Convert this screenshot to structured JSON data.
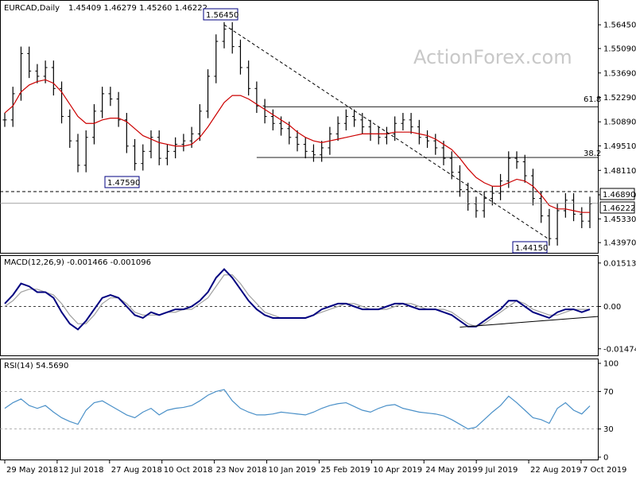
{
  "header": {
    "symbol": "EURCAD,Daily",
    "ohlc": "1.45409 1.46279 1.45260 1.46222",
    "watermark": "ActionForex.com"
  },
  "colors": {
    "candles": "#000000",
    "sma": "#cc0000",
    "macd_line": "#000080",
    "macd_signal": "#a0a0a0",
    "rsi_line": "#4a90c8",
    "trend_line": "#000000",
    "level_line": "#000000"
  },
  "chart_data": [
    {
      "type": "line",
      "panel": "price",
      "title": "EURCAD,Daily",
      "ylim": [
        1.4375,
        1.5705
      ],
      "y_ticks": [
        "1.56450",
        "1.55090",
        "1.53690",
        "1.52290",
        "1.50890",
        "1.49510",
        "1.48110",
        "1.46710",
        "1.45330",
        "1.43970"
      ],
      "x_ticks": [
        "29 May 2018",
        "12 Jul 2018",
        "27 Aug 2018",
        "10 Oct 2018",
        "23 Nov 2018",
        "10 Jan 2019",
        "25 Feb 2019",
        "10 Apr 2019",
        "24 May 2019",
        "9 Jul 2019",
        "22 Aug 2019",
        "7 Oct 2019"
      ],
      "series": [
        {
          "kind": "ohlc-close",
          "x": [
            "2018-05-29",
            "2018-06-05",
            "2018-06-12",
            "2018-06-19",
            "2018-06-26",
            "2018-07-03",
            "2018-07-10",
            "2018-07-17",
            "2018-07-24",
            "2018-07-31",
            "2018-08-07",
            "2018-08-14",
            "2018-08-21",
            "2018-08-28",
            "2018-09-04",
            "2018-09-11",
            "2018-09-18",
            "2018-09-25",
            "2018-10-02",
            "2018-10-09",
            "2018-10-16",
            "2018-10-23",
            "2018-10-30",
            "2018-11-06",
            "2018-11-13",
            "2018-11-20",
            "2018-11-27",
            "2018-12-04",
            "2018-12-11",
            "2018-12-18",
            "2018-12-25",
            "2019-01-01",
            "2019-01-08",
            "2019-01-15",
            "2019-01-22",
            "2019-01-29",
            "2019-02-05",
            "2019-02-12",
            "2019-02-19",
            "2019-02-26",
            "2019-03-05",
            "2019-03-12",
            "2019-03-19",
            "2019-03-26",
            "2019-04-02",
            "2019-04-09",
            "2019-04-16",
            "2019-04-23",
            "2019-04-30",
            "2019-05-07",
            "2019-05-14",
            "2019-05-21",
            "2019-05-28",
            "2019-06-04",
            "2019-06-11",
            "2019-06-18",
            "2019-06-25",
            "2019-07-02",
            "2019-07-09",
            "2019-07-16",
            "2019-07-23",
            "2019-07-30",
            "2019-08-06",
            "2019-08-13",
            "2019-08-20",
            "2019-08-27",
            "2019-09-03",
            "2019-09-10",
            "2019-09-17",
            "2019-09-24",
            "2019-10-01",
            "2019-10-08",
            "2019-10-15"
          ],
          "values": [
            1.51,
            1.525,
            1.548,
            1.538,
            1.535,
            1.54,
            1.528,
            1.512,
            1.498,
            1.484,
            1.5,
            1.515,
            1.525,
            1.522,
            1.51,
            1.495,
            1.485,
            1.492,
            1.5,
            1.488,
            1.492,
            1.496,
            1.498,
            1.502,
            1.515,
            1.535,
            1.555,
            1.562,
            1.552,
            1.54,
            1.528,
            1.518,
            1.512,
            1.508,
            1.505,
            1.5,
            1.496,
            1.492,
            1.49,
            1.494,
            1.502,
            1.508,
            1.512,
            1.51,
            1.506,
            1.502,
            1.5,
            1.502,
            1.508,
            1.51,
            1.506,
            1.5,
            1.498,
            1.494,
            1.488,
            1.48,
            1.47,
            1.462,
            1.458,
            1.465,
            1.468,
            1.475,
            1.488,
            1.486,
            1.478,
            1.465,
            1.455,
            1.442,
            1.458,
            1.464,
            1.456,
            1.452,
            1.462
          ]
        },
        {
          "kind": "sma",
          "values": [
            1.514,
            1.518,
            1.526,
            1.53,
            1.532,
            1.533,
            1.531,
            1.526,
            1.519,
            1.512,
            1.508,
            1.508,
            1.51,
            1.511,
            1.511,
            1.509,
            1.505,
            1.501,
            1.499,
            1.497,
            1.496,
            1.495,
            1.495,
            1.496,
            1.5,
            1.506,
            1.513,
            1.52,
            1.524,
            1.524,
            1.522,
            1.519,
            1.516,
            1.513,
            1.51,
            1.507,
            1.503,
            1.5,
            1.498,
            1.497,
            1.498,
            1.499,
            1.5,
            1.501,
            1.502,
            1.502,
            1.502,
            1.502,
            1.503,
            1.503,
            1.503,
            1.502,
            1.501,
            1.499,
            1.496,
            1.493,
            1.488,
            1.482,
            1.477,
            1.474,
            1.472,
            1.472,
            1.474,
            1.476,
            1.475,
            1.472,
            1.467,
            1.461,
            1.459,
            1.459,
            1.458,
            1.457,
            1.457
          ]
        }
      ],
      "annotations": {
        "high_label": "1.56450",
        "low_label_1": "1.47590",
        "low_label_2": "1.44150",
        "level_label": "1.46890",
        "last_label": "1.46222",
        "fib_618": "61.8",
        "fib_382": "38.2"
      }
    },
    {
      "type": "line",
      "panel": "macd",
      "title": "MACD(12,26,9) -0.001466 -0.001096",
      "ylim": [
        -0.0162,
        0.0162
      ],
      "y_ticks": [
        "0.015137",
        "0.00",
        "-0.014749"
      ],
      "series": [
        {
          "name": "MACD",
          "values": [
            0.001,
            0.004,
            0.008,
            0.007,
            0.005,
            0.005,
            0.003,
            -0.002,
            -0.006,
            -0.008,
            -0.005,
            -0.001,
            0.003,
            0.004,
            0.003,
            0.0,
            -0.003,
            -0.004,
            -0.002,
            -0.003,
            -0.002,
            -0.001,
            -0.001,
            0.0,
            0.002,
            0.005,
            0.01,
            0.013,
            0.01,
            0.006,
            0.002,
            -0.001,
            -0.003,
            -0.004,
            -0.004,
            -0.004,
            -0.004,
            -0.004,
            -0.003,
            -0.001,
            0.0,
            0.001,
            0.001,
            0.0,
            -0.001,
            -0.001,
            -0.001,
            0.0,
            0.001,
            0.001,
            0.0,
            -0.001,
            -0.001,
            -0.001,
            -0.002,
            -0.003,
            -0.005,
            -0.007,
            -0.007,
            -0.005,
            -0.003,
            -0.001,
            0.002,
            0.002,
            0.0,
            -0.002,
            -0.003,
            -0.004,
            -0.002,
            -0.001,
            -0.001,
            -0.002,
            -0.001
          ]
        },
        {
          "name": "Signal",
          "values": [
            0.0,
            0.002,
            0.005,
            0.006,
            0.006,
            0.005,
            0.004,
            0.001,
            -0.003,
            -0.006,
            -0.006,
            -0.003,
            0.001,
            0.003,
            0.003,
            0.001,
            -0.002,
            -0.003,
            -0.003,
            -0.003,
            -0.002,
            -0.002,
            -0.001,
            -0.001,
            0.001,
            0.003,
            0.007,
            0.011,
            0.011,
            0.008,
            0.004,
            0.001,
            -0.002,
            -0.003,
            -0.004,
            -0.004,
            -0.004,
            -0.004,
            -0.003,
            -0.002,
            -0.001,
            0.0,
            0.001,
            0.001,
            0.0,
            -0.001,
            -0.001,
            -0.001,
            0.0,
            0.001,
            0.001,
            0.0,
            -0.001,
            -0.001,
            -0.001,
            -0.002,
            -0.004,
            -0.006,
            -0.007,
            -0.006,
            -0.004,
            -0.002,
            0.0,
            0.002,
            0.001,
            -0.001,
            -0.002,
            -0.003,
            -0.003,
            -0.002,
            -0.001,
            -0.001,
            -0.001
          ]
        }
      ]
    },
    {
      "type": "line",
      "panel": "rsi",
      "title": "RSI(14) 54.5690",
      "ylim": [
        0,
        100
      ],
      "y_ticks": [
        "100",
        "70",
        "30",
        "0"
      ],
      "series": [
        {
          "name": "RSI",
          "values": [
            52,
            58,
            62,
            55,
            52,
            55,
            48,
            42,
            38,
            35,
            50,
            58,
            60,
            55,
            50,
            45,
            42,
            48,
            52,
            45,
            50,
            52,
            53,
            55,
            60,
            66,
            70,
            72,
            60,
            52,
            48,
            45,
            45,
            46,
            48,
            47,
            46,
            45,
            48,
            52,
            55,
            57,
            58,
            54,
            50,
            48,
            52,
            55,
            56,
            52,
            50,
            48,
            47,
            46,
            44,
            40,
            35,
            30,
            32,
            40,
            48,
            55,
            65,
            58,
            50,
            42,
            40,
            36,
            52,
            58,
            50,
            46,
            54.569
          ]
        }
      ]
    }
  ]
}
